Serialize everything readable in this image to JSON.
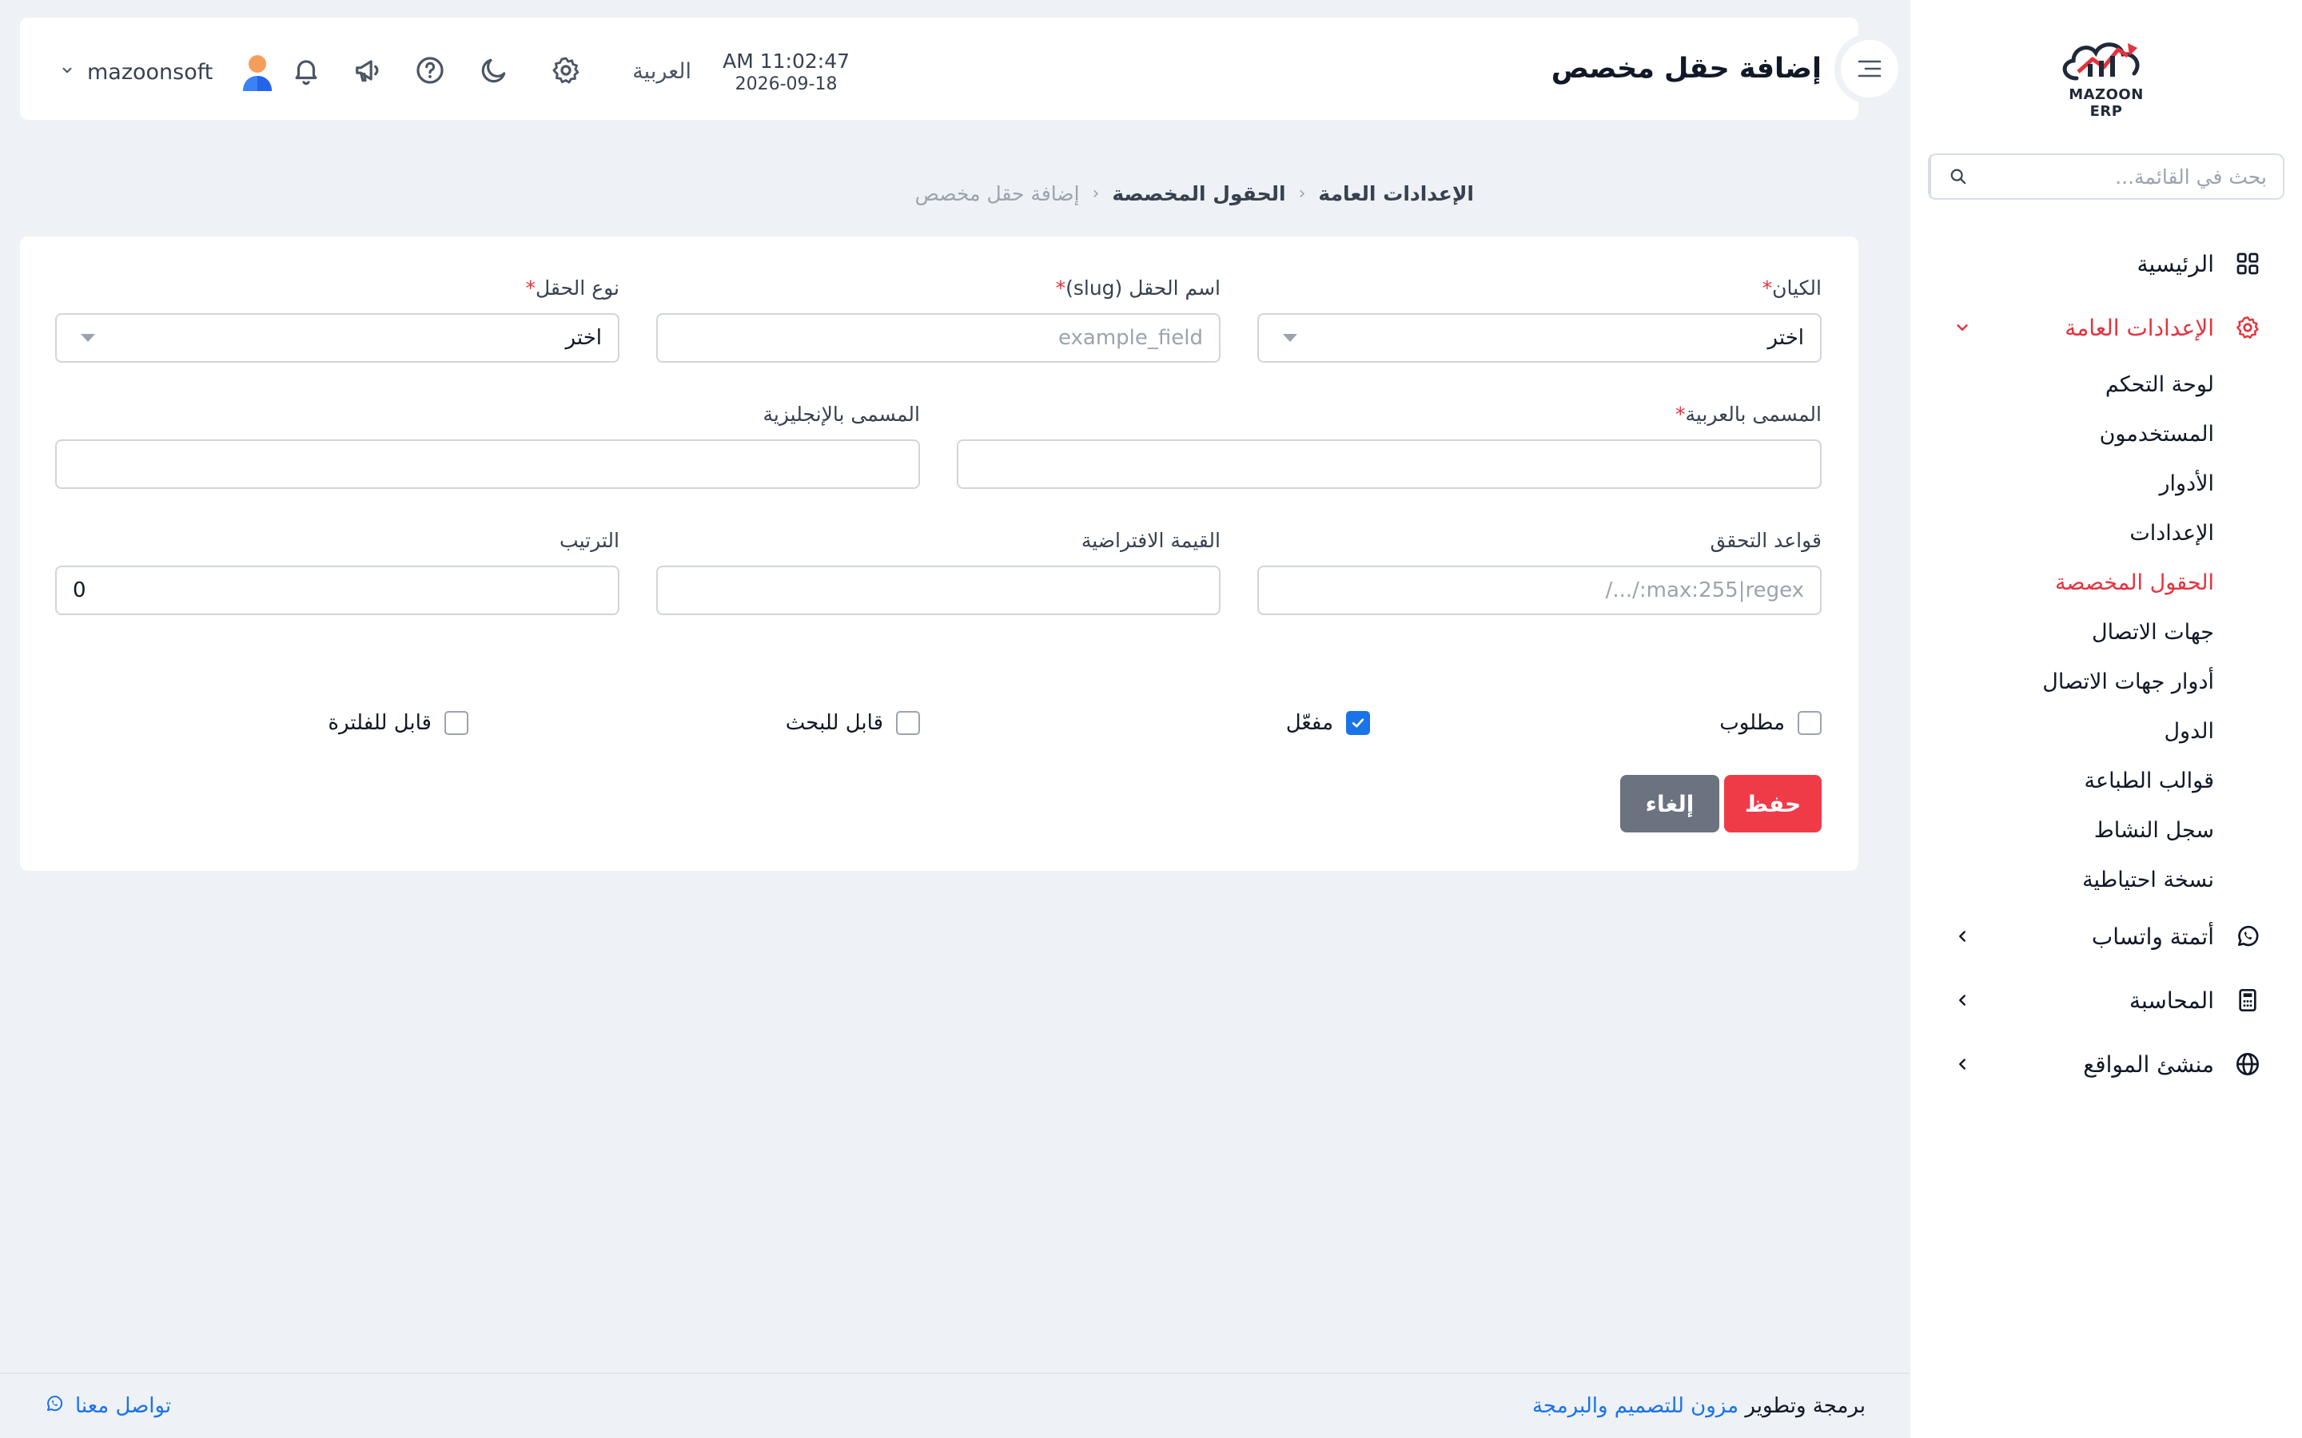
{
  "sidebar": {
    "logo_text": "MAZOON ERP",
    "search_placeholder": "بحث في القائمة...",
    "items": [
      {
        "label": "الرئيسية",
        "icon": "grid-icon"
      },
      {
        "label": "الإعدادات العامة",
        "icon": "gear-icon",
        "active": true
      },
      {
        "label": "أتمتة واتساب",
        "icon": "whatsapp-icon"
      },
      {
        "label": "المحاسبة",
        "icon": "calculator-icon"
      },
      {
        "label": "منشئ المواقع",
        "icon": "globe-icon"
      }
    ],
    "subitems": [
      {
        "label": "لوحة التحكم"
      },
      {
        "label": "المستخدمون"
      },
      {
        "label": "الأدوار"
      },
      {
        "label": "الإعدادات"
      },
      {
        "label": "الحقول المخصصة",
        "active": true
      },
      {
        "label": "جهات الاتصال"
      },
      {
        "label": "أدوار جهات الاتصال"
      },
      {
        "label": "الدول"
      },
      {
        "label": "قوالب الطباعة"
      },
      {
        "label": "سجل النشاط"
      },
      {
        "label": "نسخة احتياطية"
      }
    ]
  },
  "header": {
    "title": "إضافة حقل مخصص",
    "time": "11:02:47 AM",
    "date": "2026-09-18",
    "language": "العربية",
    "username": "mazoonsoft"
  },
  "breadcrumb": {
    "items": [
      "الإعدادات العامة",
      "الحقول المخصصة",
      "إضافة حقل مخصص"
    ]
  },
  "form": {
    "entity": {
      "label": "الكيان",
      "value": "اختر"
    },
    "slug": {
      "label": "اسم الحقل (slug)",
      "placeholder": "example_field"
    },
    "type": {
      "label": "نوع الحقل",
      "value": "اختر"
    },
    "label_ar": {
      "label": "المسمى بالعربية",
      "value": ""
    },
    "label_en": {
      "label": "المسمى بالإنجليزية",
      "value": ""
    },
    "validation": {
      "label": "قواعد التحقق",
      "placeholder": "max:255|regex:/.../"
    },
    "default_value": {
      "label": "القيمة الافتراضية",
      "value": ""
    },
    "order": {
      "label": "الترتيب",
      "value": "0"
    },
    "checkboxes": [
      {
        "label": "مطلوب",
        "checked": false
      },
      {
        "label": "مفعّل",
        "checked": true
      },
      {
        "label": "قابل للبحث",
        "checked": false
      },
      {
        "label": "قابل للفلترة",
        "checked": false
      }
    ],
    "save_label": "حفظ",
    "cancel_label": "إلغاء"
  },
  "footer": {
    "credit_prefix": "برمجة وتطوير",
    "credit_link": "مزون للتصميم والبرمجة",
    "contact": "تواصل معنا"
  },
  "colors": {
    "accent": "#e5323e",
    "primary": "#1a73e8",
    "cancel": "#6b7280"
  }
}
